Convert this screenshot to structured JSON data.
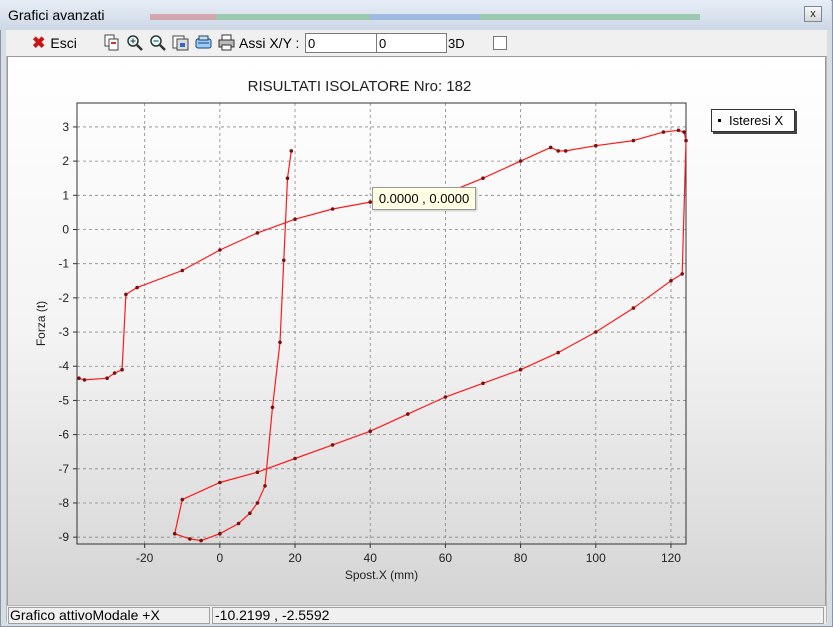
{
  "window": {
    "title": "Grafici avanzati",
    "close_glyph": "x"
  },
  "toolbar": {
    "exit_label": "Esci",
    "axes_label": "Assi X/Y :",
    "x_value": "0",
    "y_value": "0",
    "mode_3d_label": "3D",
    "icons": [
      "copy-icon",
      "zoom-in-icon",
      "zoom-out-icon",
      "save-icon",
      "export-icon",
      "print-icon"
    ]
  },
  "chart_data": {
    "type": "line",
    "title": "RISULTATI ISOLATORE Nro: 182",
    "xlabel": "Spost.X (mm)",
    "ylabel": "Forza (t)",
    "xlim": [
      -38,
      124
    ],
    "ylim": [
      -9.2,
      3.7
    ],
    "x_ticks": [
      -20,
      0,
      20,
      40,
      60,
      80,
      100,
      120
    ],
    "y_ticks": [
      3,
      2,
      1,
      0,
      -1,
      -2,
      -3,
      -4,
      -5,
      -6,
      -7,
      -8,
      -9
    ],
    "grid": true,
    "legend_position": "top-right",
    "series": [
      {
        "name": "Isteresi X",
        "color": "#ff1a1a",
        "marker_color": "#7a1010",
        "points": [
          [
            -37.5,
            -4.35
          ],
          [
            -36,
            -4.4
          ],
          [
            -30,
            -4.35
          ],
          [
            -28,
            -4.2
          ],
          [
            -26,
            -4.1
          ],
          [
            -25,
            -1.9
          ],
          [
            -22,
            -1.7
          ],
          [
            -10,
            -1.2
          ],
          [
            0,
            -0.6
          ],
          [
            10,
            -0.1
          ],
          [
            20,
            0.3
          ],
          [
            30,
            0.6
          ],
          [
            40,
            0.8
          ],
          [
            50,
            0.95
          ],
          [
            60,
            1.05
          ],
          [
            70,
            1.5
          ],
          [
            80,
            2.0
          ],
          [
            88,
            2.4
          ],
          [
            90,
            2.3
          ],
          [
            92,
            2.3
          ],
          [
            100,
            2.45
          ],
          [
            110,
            2.6
          ],
          [
            118,
            2.85
          ],
          [
            122,
            2.9
          ],
          [
            123.5,
            2.85
          ],
          [
            124,
            2.6
          ],
          [
            123,
            -1.3
          ],
          [
            120,
            -1.5
          ],
          [
            110,
            -2.3
          ],
          [
            100,
            -3.0
          ],
          [
            90,
            -3.6
          ],
          [
            80,
            -4.1
          ],
          [
            70,
            -4.5
          ],
          [
            60,
            -4.9
          ],
          [
            50,
            -5.4
          ],
          [
            40,
            -5.9
          ],
          [
            30,
            -6.3
          ],
          [
            20,
            -6.7
          ],
          [
            10,
            -7.1
          ],
          [
            0,
            -7.4
          ],
          [
            -10,
            -7.9
          ],
          [
            -12,
            -8.9
          ],
          [
            -8,
            -9.05
          ],
          [
            -5,
            -9.1
          ],
          [
            0,
            -8.9
          ],
          [
            5,
            -8.6
          ],
          [
            8,
            -8.3
          ],
          [
            10,
            -8.0
          ],
          [
            12,
            -7.5
          ],
          [
            14,
            -5.2
          ],
          [
            16,
            -3.3
          ],
          [
            17,
            -0.9
          ],
          [
            18,
            1.5
          ],
          [
            19,
            2.3
          ]
        ]
      }
    ]
  },
  "tooltip": {
    "text": "0.0000 , 0.0000"
  },
  "status": {
    "active_chart": "Grafico attivoModale +X",
    "cursor_coords": "-10.2199 , -2.5592"
  }
}
